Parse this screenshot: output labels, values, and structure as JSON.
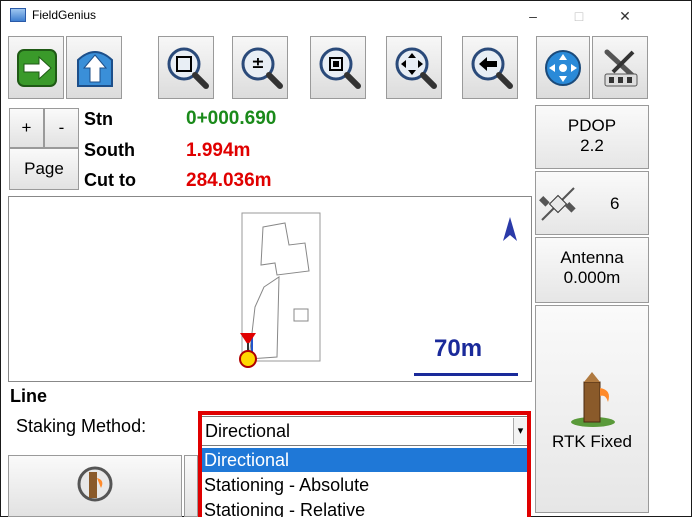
{
  "app": {
    "title": "FieldGenius"
  },
  "window": {
    "minimize": "–",
    "maximize": "□",
    "close": "✕"
  },
  "toolbar": {
    "buttons": [
      "next-arrow-icon",
      "up-arrow-icon",
      "zoom-center-icon",
      "zoom-plus-minus-icon",
      "zoom-window-icon",
      "pan-icon",
      "zoom-previous-icon",
      "globe-icon",
      "tools-icon"
    ]
  },
  "panel": {
    "plus": "+",
    "minus": "-",
    "page": "Page",
    "rows": [
      {
        "label": "Stn",
        "value": "0+000.690",
        "color": "#1a8a1a"
      },
      {
        "label": "South",
        "value": "1.994m",
        "color": "#e00000"
      },
      {
        "label": "Cut to",
        "value": "284.036m",
        "color": "#e00000"
      }
    ]
  },
  "gps": {
    "pdop_label": "PDOP",
    "pdop_value": "2.2",
    "satellites": "6",
    "antenna_label": "Antenna",
    "antenna_value": "0.000m",
    "status": "RTK Fixed"
  },
  "map": {
    "scale": "70m"
  },
  "staking": {
    "heading": "Line",
    "method_label": "Staking Method:",
    "selected": "Directional",
    "options": [
      "Directional",
      "Stationing - Absolute",
      "Stationing - Relative"
    ]
  }
}
